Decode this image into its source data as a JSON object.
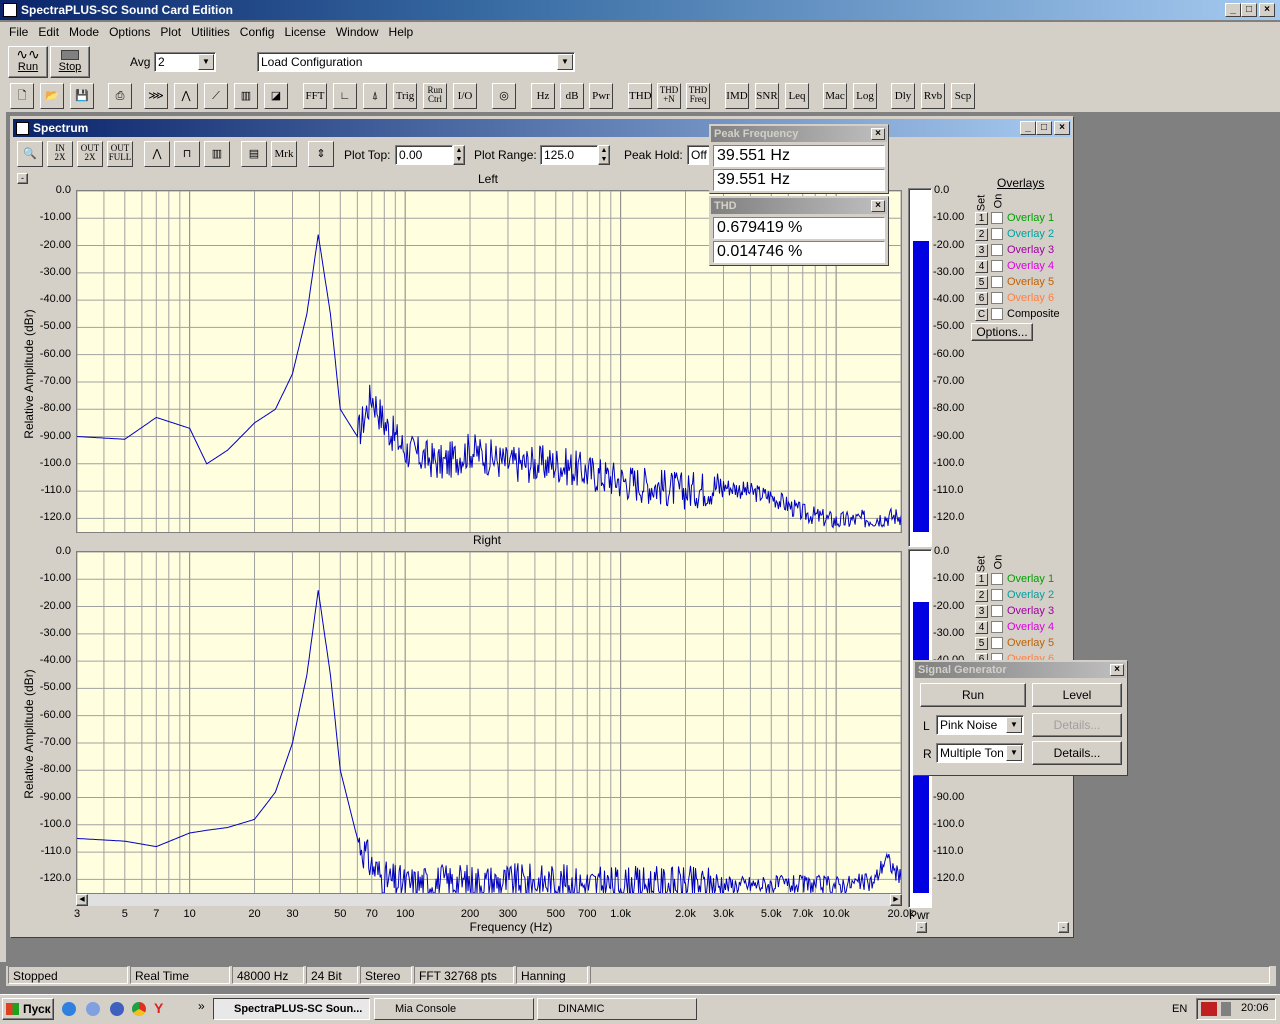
{
  "app": {
    "title": "SpectraPLUS-SC Sound Card Edition",
    "menu": [
      "File",
      "Edit",
      "Mode",
      "Options",
      "Plot",
      "Utilities",
      "Config",
      "License",
      "Window",
      "Help"
    ]
  },
  "toolbar1": {
    "run": "Run",
    "stop": "Stop",
    "avg_label": "Avg",
    "avg_value": "2",
    "config_value": "Load Configuration"
  },
  "toolbar2": {
    "buttons": [
      "FFT",
      "Trig",
      "Run Ctrl",
      "I/O",
      "Hz",
      "dB",
      "Pwr",
      "THD",
      "THD +N",
      "THD Freq",
      "IMD",
      "SNR",
      "Leq",
      "Mac",
      "Log",
      "Dly",
      "Rvb",
      "Scp"
    ]
  },
  "spectrum": {
    "title": "Spectrum",
    "plot_top_label": "Plot Top:",
    "plot_top_value": "0.00",
    "plot_range_label": "Plot Range:",
    "plot_range_value": "125.0",
    "peak_hold_label": "Peak Hold:",
    "peak_hold_value": "Off",
    "mrk": "Mrk",
    "left_title": "Left",
    "right_title": "Right",
    "ylabel": "Relative Amplitude (dBr)",
    "xlabel": "Frequency (Hz)",
    "pwr": "Pwr",
    "y_ticks": [
      "0.0",
      "-10.00",
      "-20.00",
      "-30.00",
      "-40.00",
      "-50.00",
      "-60.00",
      "-70.00",
      "-80.00",
      "-90.00",
      "-100.0",
      "-110.0",
      "-120.0"
    ],
    "x_ticks": [
      "3",
      "5",
      "7",
      "10",
      "20",
      "30",
      "50",
      "70",
      "100",
      "200",
      "300",
      "500",
      "700",
      "1.0k",
      "2.0k",
      "3.0k",
      "5.0k",
      "7.0k",
      "10.0k",
      "20.0k"
    ],
    "overlays_title": "Overlays",
    "set_label": "Set",
    "on_label": "On",
    "overlays": [
      {
        "num": "1",
        "name": "Overlay 1",
        "color": "#00a000"
      },
      {
        "num": "2",
        "name": "Overlay 2",
        "color": "#00a0a0"
      },
      {
        "num": "3",
        "name": "Overlay 3",
        "color": "#a000a0"
      },
      {
        "num": "4",
        "name": "Overlay 4",
        "color": "#e000e0"
      },
      {
        "num": "5",
        "name": "Overlay 5",
        "color": "#c06000"
      },
      {
        "num": "6",
        "name": "Overlay 6",
        "color": "#ff8040"
      }
    ],
    "composite": {
      "num": "C",
      "name": "Composite"
    },
    "options_btn": "Options...",
    "meter_left_fraction": 0.88,
    "meter_right_fraction": 0.88
  },
  "peak_frequency": {
    "title": "Peak Frequency",
    "value1": "39.551 Hz",
    "value2": "39.551 Hz"
  },
  "thd": {
    "title": "THD",
    "value1": "0.679419 %",
    "value2": "0.014746 %"
  },
  "signal_generator": {
    "title": "Signal Generator",
    "run": "Run",
    "level": "Level",
    "l_label": "L",
    "r_label": "R",
    "l_value": "Pink Noise",
    "r_value": "Multiple Ton",
    "details_disabled": "Details...",
    "details": "Details..."
  },
  "status": [
    "Stopped",
    "Real Time",
    "48000 Hz",
    "24 Bit",
    "Stereo",
    "FFT 32768 pts",
    "Hanning"
  ],
  "taskbar": {
    "start": "Пуск",
    "items": [
      "SpectraPLUS-SC Soun...",
      "Mia Console",
      "DINAMIC"
    ],
    "lang": "EN",
    "clock": "20:06"
  },
  "chart_data": [
    {
      "type": "line",
      "title": "Left",
      "xlabel": "Frequency (Hz)",
      "ylabel": "Relative Amplitude (dBr)",
      "xscale": "log",
      "xlim": [
        3,
        20000
      ],
      "ylim": [
        -125,
        0
      ],
      "x": [
        3,
        5,
        7,
        10,
        12,
        15,
        20,
        25,
        30,
        35,
        39.5,
        45,
        50,
        60,
        70,
        80,
        100,
        150,
        200,
        300,
        500,
        700,
        1000,
        2000,
        3000,
        5000,
        7000,
        10000,
        15000,
        20000
      ],
      "y": [
        -90,
        -91,
        -83,
        -87,
        -100,
        -95,
        -85,
        -80,
        -67,
        -45,
        -16,
        -45,
        -80,
        -90,
        -75,
        -85,
        -95,
        -100,
        -95,
        -100,
        -100,
        -103,
        -106,
        -110,
        -108,
        -112,
        -118,
        -121,
        -120,
        -119
      ],
      "series_color": "#0000c0"
    },
    {
      "type": "line",
      "title": "Right",
      "xlabel": "Frequency (Hz)",
      "ylabel": "Relative Amplitude (dBr)",
      "xscale": "log",
      "xlim": [
        3,
        20000
      ],
      "ylim": [
        -125,
        0
      ],
      "x": [
        3,
        5,
        7,
        10,
        12,
        15,
        20,
        25,
        30,
        35,
        39.5,
        45,
        50,
        60,
        70,
        80,
        100,
        150,
        200,
        300,
        500,
        700,
        1000,
        2000,
        3000,
        5000,
        7000,
        10000,
        15000,
        17000,
        20000
      ],
      "y": [
        -105,
        -106,
        -108,
        -103,
        -102,
        -101,
        -98,
        -88,
        -70,
        -45,
        -14,
        -45,
        -80,
        -105,
        -115,
        -120,
        -122,
        -121,
        -121,
        -121,
        -121,
        -122,
        -122,
        -122,
        -122,
        -122,
        -122,
        -122,
        -121,
        -112,
        -120
      ],
      "series_color": "#0000c0"
    }
  ]
}
